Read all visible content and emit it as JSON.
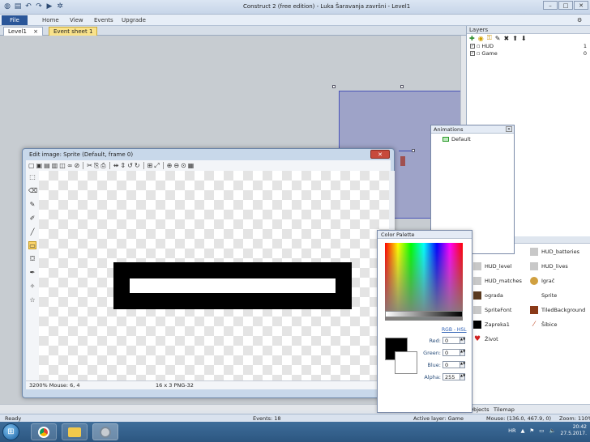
{
  "window": {
    "title": "Construct 2 (free edition) - Luka Šaravanja završni - Level1",
    "minimize": "–",
    "maximize": "□",
    "close": "✕"
  },
  "ribbon": {
    "file": "File",
    "tabs": [
      "Home",
      "View",
      "Events",
      "Upgrade"
    ]
  },
  "doc_tabs": [
    {
      "label": "Level1",
      "close": "×"
    },
    {
      "label": "Event sheet 1"
    }
  ],
  "layers": {
    "title": "Layers",
    "toolbar_icons": [
      "add-icon",
      "eye-icon",
      "lock-icon",
      "edit-icon",
      "delete-icon",
      "up-icon",
      "down-icon"
    ],
    "rows": [
      {
        "name": "HUD",
        "number": "1"
      },
      {
        "name": "Game",
        "number": "0"
      }
    ]
  },
  "animations": {
    "title": "Animations",
    "items": [
      "Default"
    ]
  },
  "edit_image": {
    "title": "Edit image: Sprite (Default, frame 0)",
    "status_zoom_mouse": "3200% Mouse: 6, 4",
    "status_size": "16 x 3  PNG-32"
  },
  "color_palette": {
    "title": "Color Palette",
    "mode_link": "RGB - HSL",
    "fields": [
      {
        "label": "Red:",
        "value": "0"
      },
      {
        "label": "Green:",
        "value": "0"
      },
      {
        "label": "Blue:",
        "value": "0"
      },
      {
        "label": "Alpha:",
        "value": "255"
      }
    ]
  },
  "objects": {
    "items": [
      {
        "name": "HUD_batteries",
        "color": "#c8c8c8"
      },
      {
        "name": "HUD_level",
        "color": "#c8c8c8"
      },
      {
        "name": "HUD_lives",
        "color": "#c8c8c8"
      },
      {
        "name": "HUD_matches",
        "color": "#c8c8c8"
      },
      {
        "name": "Igrač",
        "color": "#d0a040"
      },
      {
        "name": "ograda",
        "color": "#5a3a20"
      },
      {
        "name": "Sprite",
        "color": "#ffffff"
      },
      {
        "name": "SpriteFont",
        "color": "#c8c8c8"
      },
      {
        "name": "TiledBackground",
        "color": "#8a3a18"
      },
      {
        "name": "Zapreka1",
        "color": "#000000"
      },
      {
        "name": "Šibice",
        "color": "#c86040"
      },
      {
        "name": "Život",
        "color": "#d02020"
      }
    ],
    "tabs": [
      "Objects",
      "Tilemap"
    ]
  },
  "status_bar": {
    "ready": "Ready",
    "events": "Events: 18",
    "active_layer": "Active layer: Game",
    "mouse": "Mouse: (136.0, 467.9, 0)",
    "zoom": "Zoom: 110%"
  },
  "taskbar": {
    "tray_lang": "HR",
    "time": "20:42",
    "date": "27.5.2017."
  }
}
